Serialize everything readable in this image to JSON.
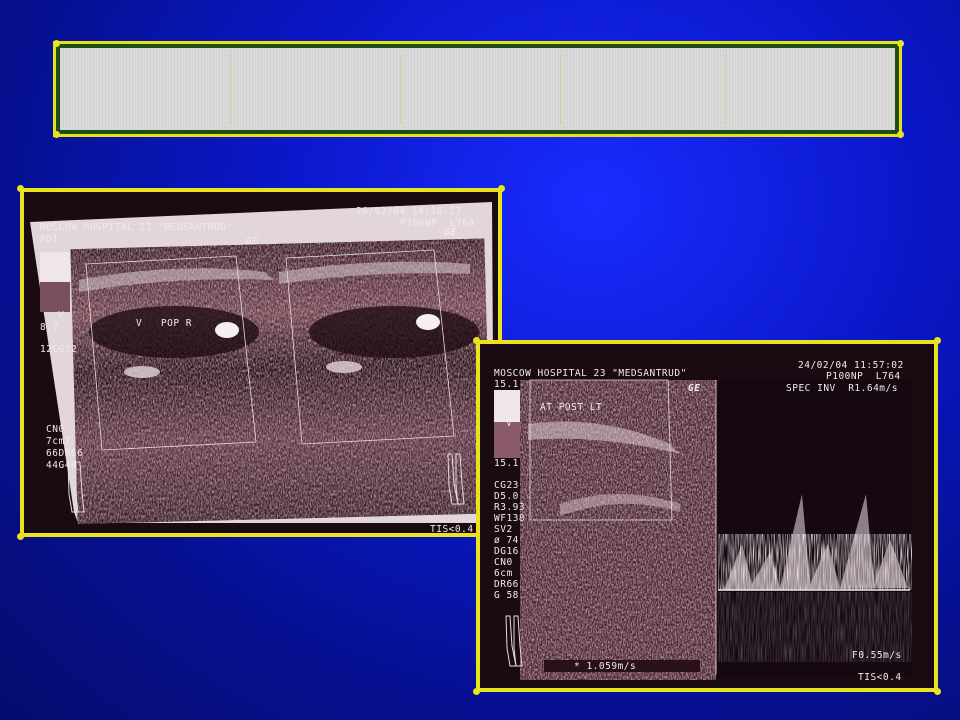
{
  "banner": {
    "title": ""
  },
  "left_scan": {
    "hospital": "MOSCOW HOSPITAL 23 \"MEDSANTRUD\"",
    "datetime": "26/02/04 14:16:13",
    "probe": "P100NP  L764",
    "mode": "PDI",
    "brand": "GE",
    "scale_label": "V",
    "scale_value": "8.7",
    "gain_code": "12CG12",
    "vessel_label": "V   POP R",
    "params": [
      "CN0",
      "7cm7",
      "66DR66",
      "44G44"
    ],
    "tis": "TIS<0.4"
  },
  "right_scan": {
    "hospital": "MOSCOW HOSPITAL 23 \"MEDSANTRUD\"",
    "datetime": "24/02/04 11:57:02",
    "probe": "P100NP  L764",
    "mode_info": "SPEC INV  R1.64m/s",
    "brand": "GE",
    "scale_top": "15.1",
    "scale_bottom": "15.1",
    "scale_label": "V",
    "vessel_label": "AT POST LT",
    "params": [
      "CG23",
      "D5.0",
      "R3.93",
      "WF138",
      "SV2",
      "ø 74",
      "DG16",
      "CN0",
      "6cm",
      "DR66",
      "G 58"
    ],
    "velocity": "* 1.059m/s",
    "f_value": "F0.55m/s",
    "tis": "TIS<0.4"
  },
  "colors": {
    "frame": "#e8e31c",
    "banner_border": "#1f4d14",
    "background": "#0a17c8"
  }
}
